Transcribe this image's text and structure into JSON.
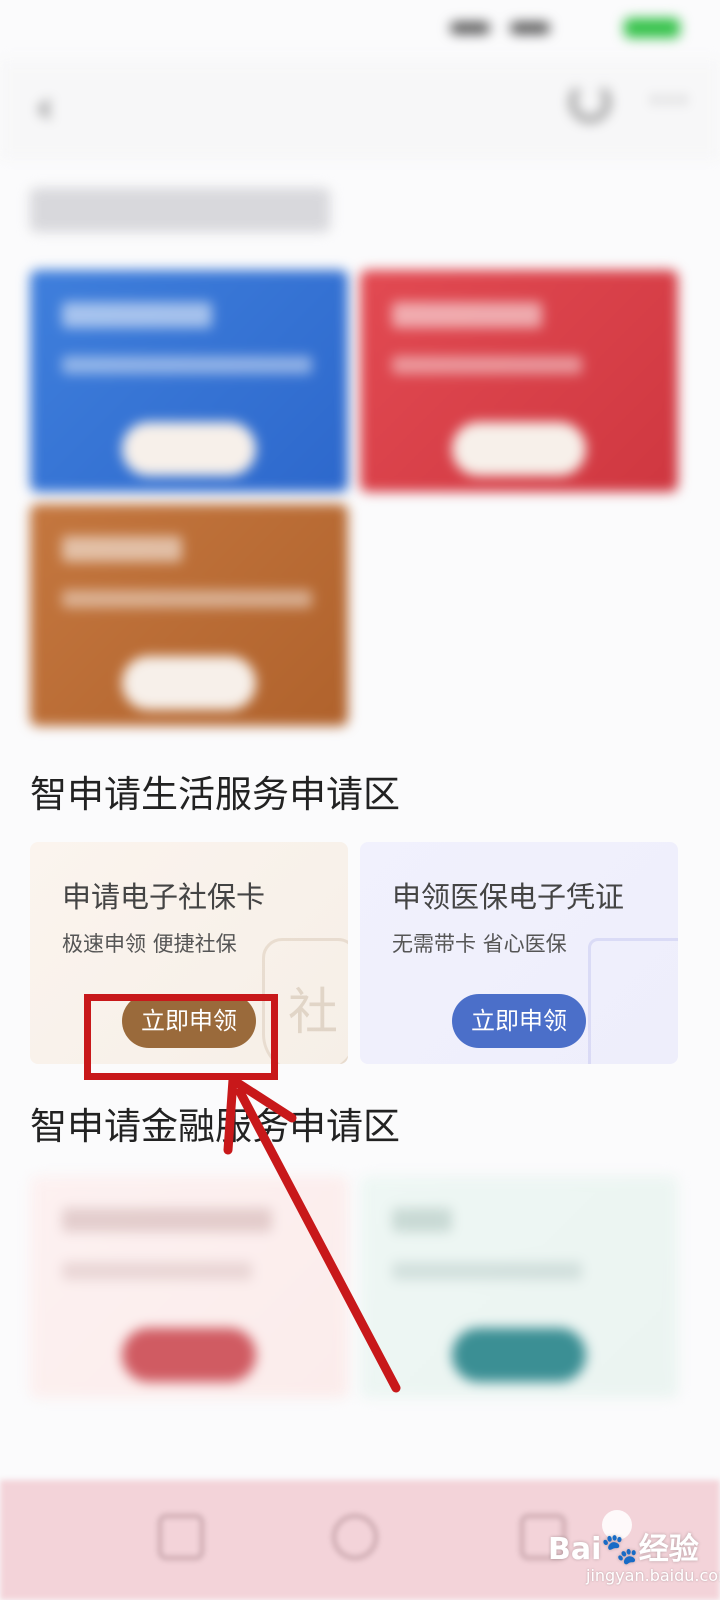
{
  "life_section": {
    "title": "智申请生活服务申请区",
    "cards": [
      {
        "title": "申请电子社保卡",
        "subtitle": "极速申领 便捷社保",
        "button": "立即申领",
        "watermark": "社"
      },
      {
        "title": "申领医保电子凭证",
        "subtitle": "无需带卡 省心医保",
        "button": "立即申领"
      }
    ]
  },
  "finance_section": {
    "title": "智申请金融服务申请区"
  },
  "watermark": {
    "brand": "Bai🐾经验",
    "url": "jingyan.baidu.com"
  },
  "colors": {
    "highlight_red": "#c8181a",
    "gold_button": "#9a6a3b",
    "blue_button": "#4b6fc9",
    "tabbar_pink": "#f3d3d9"
  }
}
